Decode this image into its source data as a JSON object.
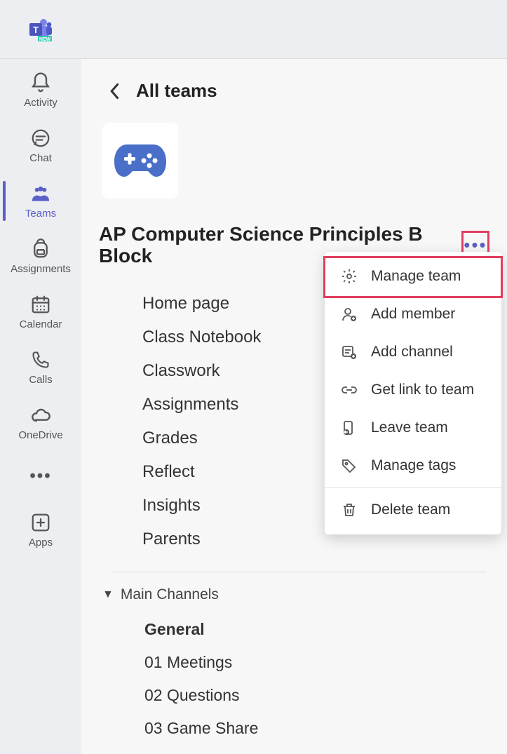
{
  "app_rail": [
    {
      "id": "activity",
      "label": "Activity",
      "selected": false
    },
    {
      "id": "chat",
      "label": "Chat",
      "selected": false
    },
    {
      "id": "teams",
      "label": "Teams",
      "selected": true
    },
    {
      "id": "assignments",
      "label": "Assignments",
      "selected": false
    },
    {
      "id": "calendar",
      "label": "Calendar",
      "selected": false
    },
    {
      "id": "calls",
      "label": "Calls",
      "selected": false
    },
    {
      "id": "onedrive",
      "label": "OneDrive",
      "selected": false
    },
    {
      "id": "more",
      "label": "",
      "selected": false
    },
    {
      "id": "apps",
      "label": "Apps",
      "selected": false
    }
  ],
  "back": {
    "label": "All teams"
  },
  "team": {
    "name": "AP Computer Science Principles B Block"
  },
  "tabs": [
    {
      "label": "Home page"
    },
    {
      "label": "Class Notebook"
    },
    {
      "label": "Classwork"
    },
    {
      "label": "Assignments"
    },
    {
      "label": "Grades"
    },
    {
      "label": "Reflect"
    },
    {
      "label": "Insights"
    },
    {
      "label": "Parents"
    }
  ],
  "channels_section": {
    "label": "Main Channels"
  },
  "channels": [
    {
      "label": "General",
      "selected": true
    },
    {
      "label": "01 Meetings",
      "selected": false
    },
    {
      "label": "02 Questions",
      "selected": false
    },
    {
      "label": "03 Game Share",
      "selected": false
    }
  ],
  "menu": [
    {
      "id": "manage-team",
      "label": "Manage team"
    },
    {
      "id": "add-member",
      "label": "Add member"
    },
    {
      "id": "add-channel",
      "label": "Add channel"
    },
    {
      "id": "get-link",
      "label": "Get link to team"
    },
    {
      "id": "leave-team",
      "label": "Leave team"
    },
    {
      "id": "manage-tags",
      "label": "Manage tags"
    },
    {
      "id": "delete-team",
      "label": "Delete team"
    }
  ]
}
